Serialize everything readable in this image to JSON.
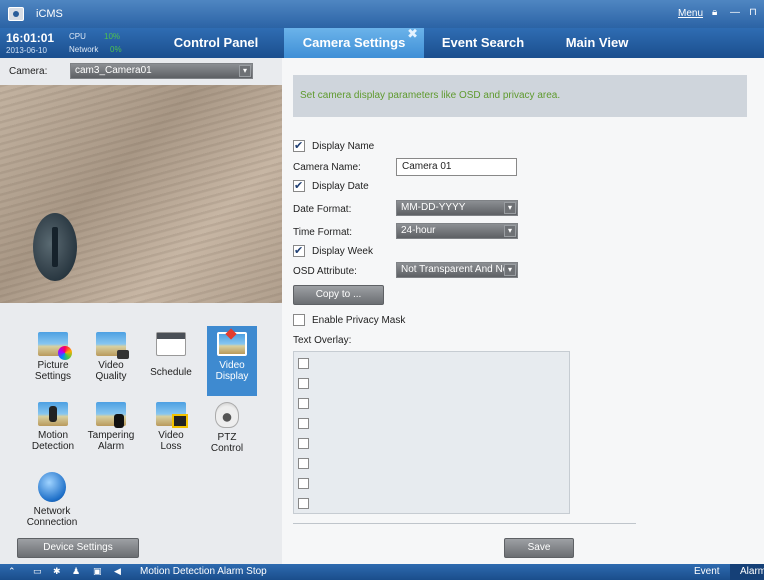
{
  "titlebar": {
    "app_name": "iCMS",
    "menu_label": "Menu",
    "lock_icon": "lock-icon",
    "minimize_icon": "minimize-icon",
    "close_icon": "close-icon"
  },
  "navbar": {
    "time": "16:01:01",
    "date": "2013-06-10",
    "cpu_label": "CPU",
    "cpu_value": "10%",
    "network_label": "Network",
    "network_value": "0%",
    "tabs": [
      {
        "label": "Control Panel",
        "active": false
      },
      {
        "label": "Camera Settings",
        "active": true,
        "close": "✖"
      },
      {
        "label": "Event Search",
        "active": false
      },
      {
        "label": "Main View",
        "active": false
      }
    ]
  },
  "left": {
    "camera_label": "Camera:",
    "camera_value": "cam3_Camera01",
    "tools": [
      {
        "line1": "Picture",
        "line2": "Settings",
        "icon": "picture-settings-icon"
      },
      {
        "line1": "Video",
        "line2": "Quality",
        "icon": "video-quality-icon"
      },
      {
        "line1": "Schedule",
        "line2": "",
        "icon": "schedule-icon"
      },
      {
        "line1": "Video",
        "line2": "Display",
        "icon": "video-display-icon",
        "active": true
      },
      {
        "line1": "Motion",
        "line2": "Detection",
        "icon": "motion-detection-icon"
      },
      {
        "line1": "Tampering",
        "line2": "Alarm",
        "icon": "tampering-alarm-icon"
      },
      {
        "line1": "Video",
        "line2": "Loss",
        "icon": "video-loss-icon"
      },
      {
        "line1": "PTZ",
        "line2": "Control",
        "icon": "ptz-control-icon"
      },
      {
        "line1": "Network",
        "line2": "Connection",
        "icon": "network-connection-icon"
      }
    ],
    "device_settings_label": "Device Settings"
  },
  "right": {
    "info_text": "Set camera display parameters like OSD and privacy area.",
    "display_name_label": "Display Name",
    "display_name_checked": true,
    "camera_name_label": "Camera Name:",
    "camera_name_value": "Camera 01",
    "display_date_label": "Display Date",
    "display_date_checked": true,
    "date_format_label": "Date Format:",
    "date_format_value": "MM-DD-YYYY",
    "time_format_label": "Time Format:",
    "time_format_value": "24-hour",
    "display_week_label": "Display Week",
    "display_week_checked": true,
    "osd_attribute_label": "OSD Attribute:",
    "osd_attribute_value": "Not Transparent And Not",
    "copy_to_label": "Copy to ...",
    "privacy_mask_label": "Enable Privacy Mask",
    "privacy_mask_checked": false,
    "text_overlay_label": "Text Overlay:",
    "text_overlay_rows": 8,
    "save_label": "Save"
  },
  "statusbar": {
    "message": "Motion Detection Alarm Stop",
    "event_label": "Event",
    "alarm_label": "Alarm"
  }
}
